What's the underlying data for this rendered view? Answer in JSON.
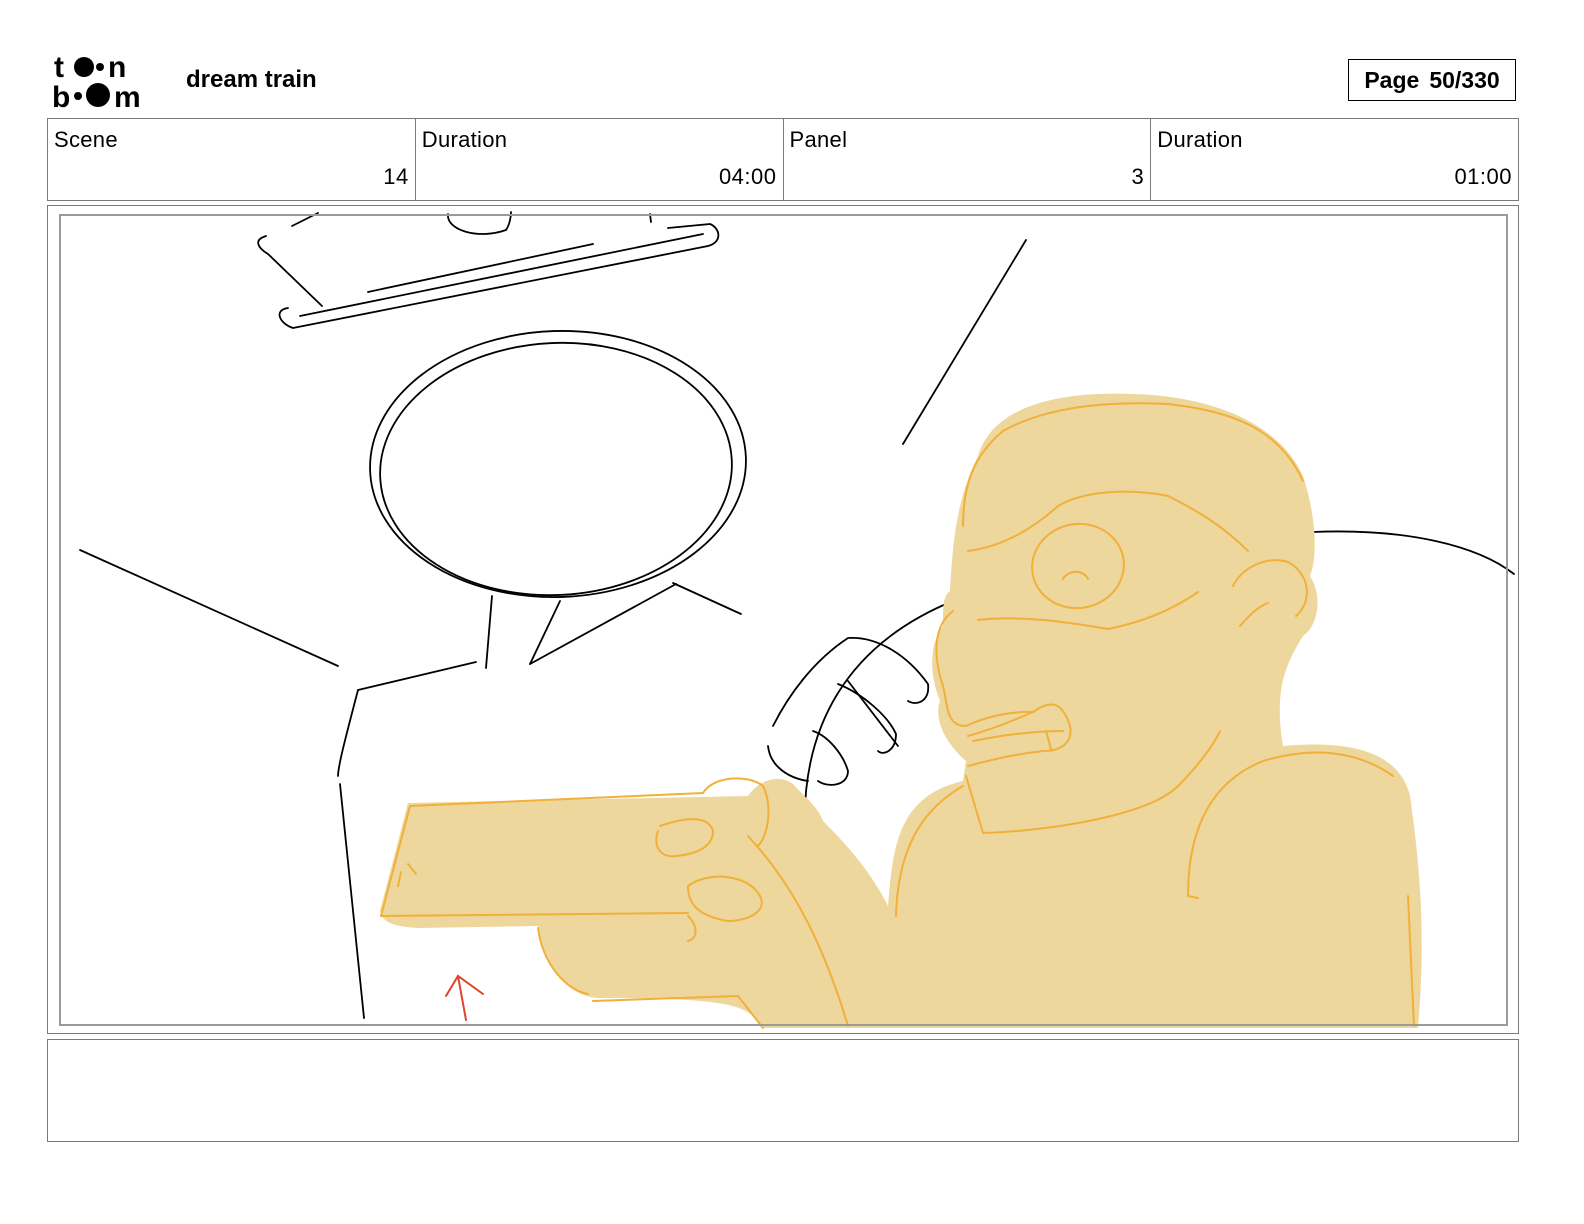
{
  "header": {
    "logo_text": "toon boom",
    "project_title": "dream train",
    "page_label": "Page",
    "page_number": "50/330"
  },
  "panel_info": [
    {
      "label": "Scene",
      "value": "14"
    },
    {
      "label": "Duration",
      "value": "04:00"
    },
    {
      "label": "Panel",
      "value": "3"
    },
    {
      "label": "Duration",
      "value": "01:00"
    }
  ],
  "notes": {
    "text": ""
  },
  "colors": {
    "character_fill": "#eed79c",
    "character_line": "#f0b03a",
    "sketch_line": "#000000",
    "arrow": "#e0442b",
    "frame_border": "#7a7a7a"
  }
}
